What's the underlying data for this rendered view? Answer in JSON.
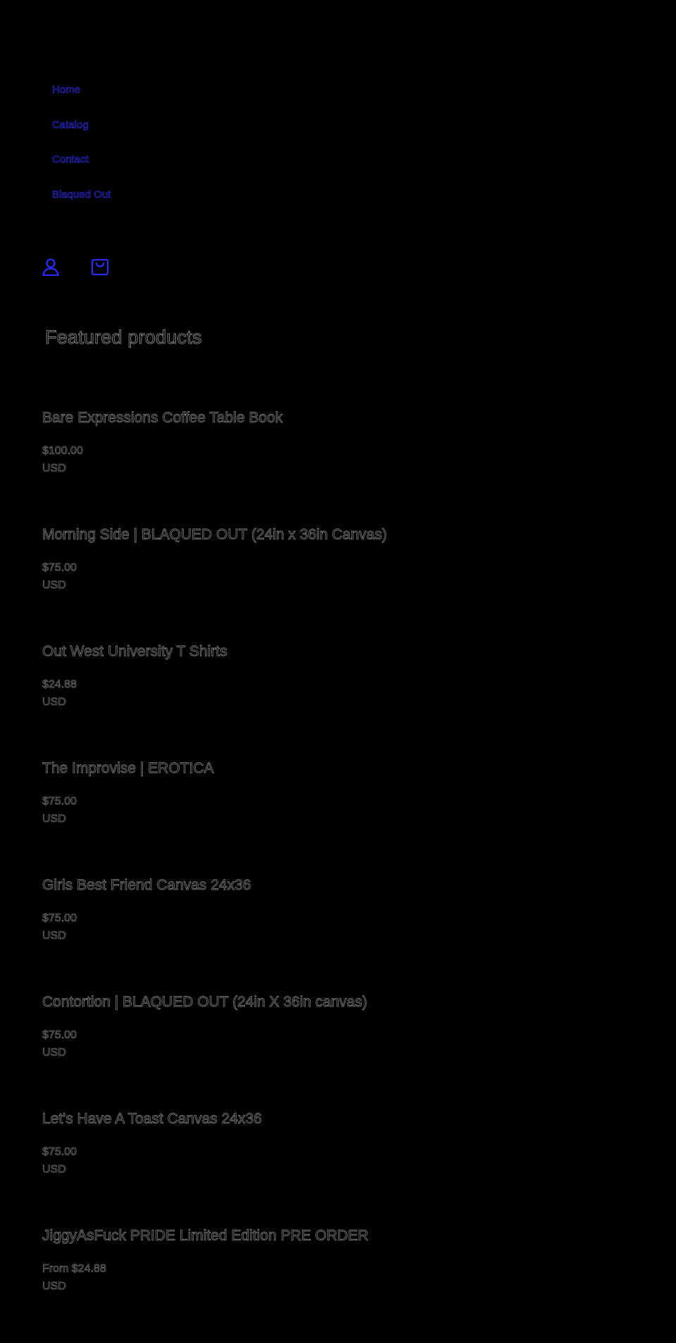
{
  "nav": {
    "items": [
      {
        "label": "Home"
      },
      {
        "label": "Catalog"
      },
      {
        "label": "Contact"
      },
      {
        "label": "Blaqued Out"
      }
    ]
  },
  "header": {
    "account_icon": "account-icon",
    "cart_icon": "cart-icon"
  },
  "featured": {
    "title": "Featured products",
    "products": [
      {
        "title": "Bare Expressions Coffee Table Book",
        "price": "$100.00",
        "currency": "USD"
      },
      {
        "title": "Morning Side | BLAQUED OUT (24in x 36in Canvas)",
        "price": "$75.00",
        "currency": "USD"
      },
      {
        "title": "Out West University T Shirts",
        "price": "$24.88",
        "currency": "USD"
      },
      {
        "title": "The Improvise | EROTICA",
        "price": "$75.00",
        "currency": "USD"
      },
      {
        "title": "Girls Best Friend Canvas 24x36",
        "price": "$75.00",
        "currency": "USD"
      },
      {
        "title": "Contortion | BLAQUED OUT (24in X 36in canvas)",
        "price": "$75.00",
        "currency": "USD"
      },
      {
        "title": "Let's Have A Toast Canvas 24x36",
        "price": "$75.00",
        "currency": "USD"
      },
      {
        "title": "JiggyAsFuck PRIDE Limited Edition PRE ORDER",
        "price": "From $24.88",
        "currency": "USD"
      }
    ]
  },
  "colors": {
    "background": "#000000",
    "link": "#3333ff",
    "text_outline": "#8a8a8a"
  }
}
